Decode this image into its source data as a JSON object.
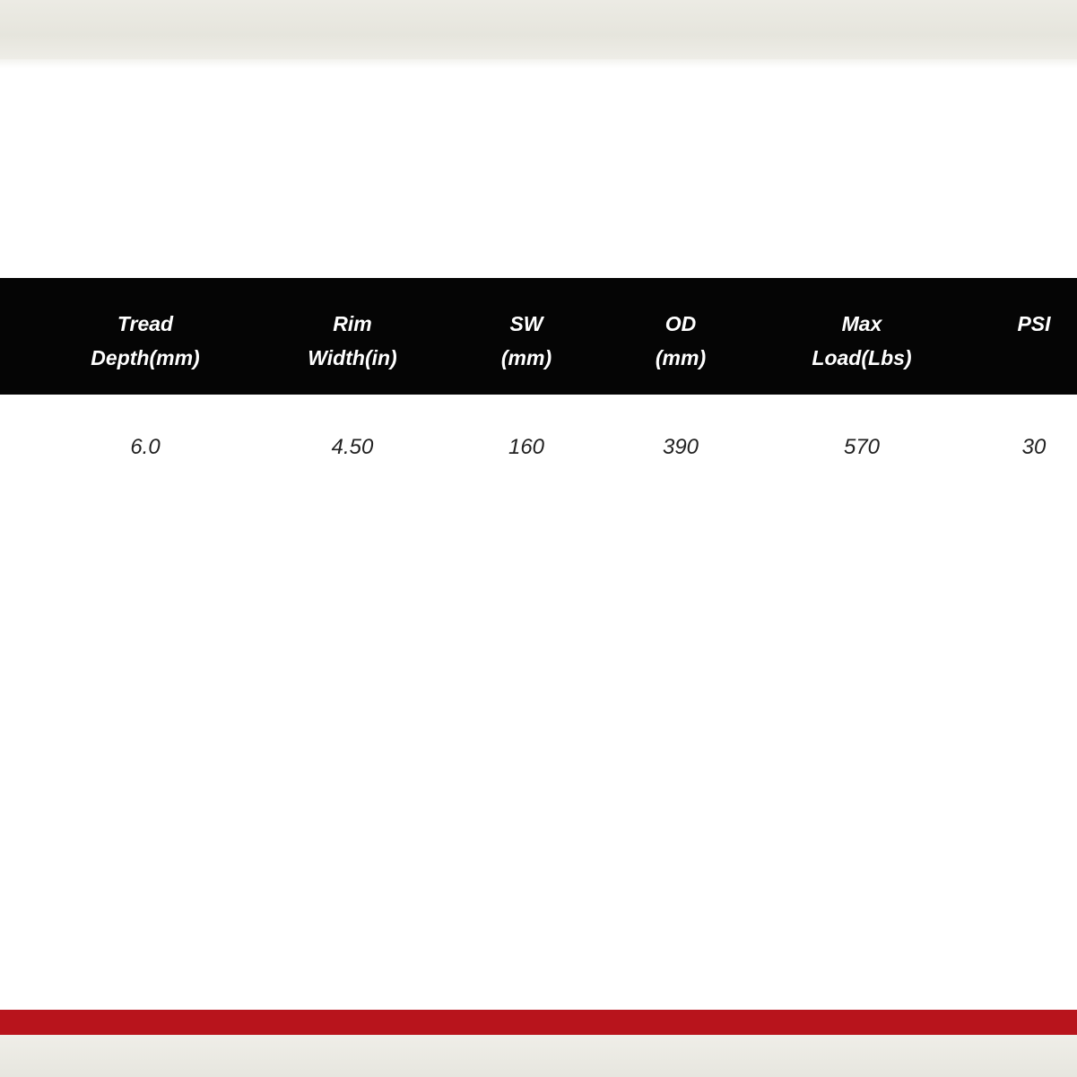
{
  "colors": {
    "header_background": "#050505",
    "accent_bar": "#b8141c",
    "band": "#e8e7e0"
  },
  "table": {
    "headers": [
      {
        "line1": "Tread",
        "line2": "Depth(mm)"
      },
      {
        "line1": "Rim",
        "line2": "Width(in)"
      },
      {
        "line1": "SW",
        "line2": "(mm)"
      },
      {
        "line1": "OD",
        "line2": "(mm)"
      },
      {
        "line1": "Max",
        "line2": "Load(Lbs)"
      },
      {
        "line1": "PSI",
        "line2": ""
      }
    ],
    "rows": [
      [
        "6.0",
        "4.50",
        "160",
        "390",
        "570",
        "30"
      ]
    ]
  }
}
